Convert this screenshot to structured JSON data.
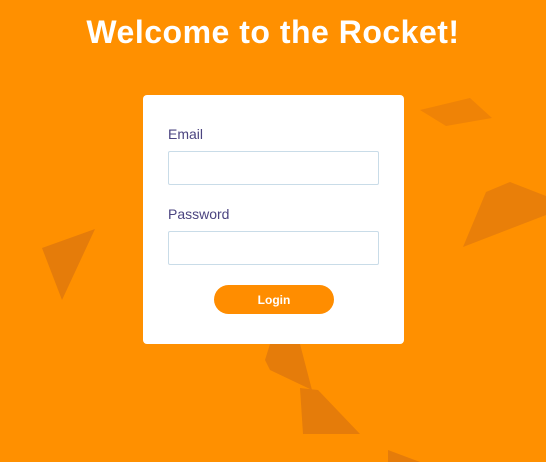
{
  "page": {
    "title": "Welcome to the Rocket!",
    "background_color": "#ff9000",
    "shape_color": "#e57c0a"
  },
  "login_form": {
    "email_label": "Email",
    "email_value": "",
    "password_label": "Password",
    "password_value": "",
    "login_label": "Login",
    "button_color": "#ff8d00"
  }
}
